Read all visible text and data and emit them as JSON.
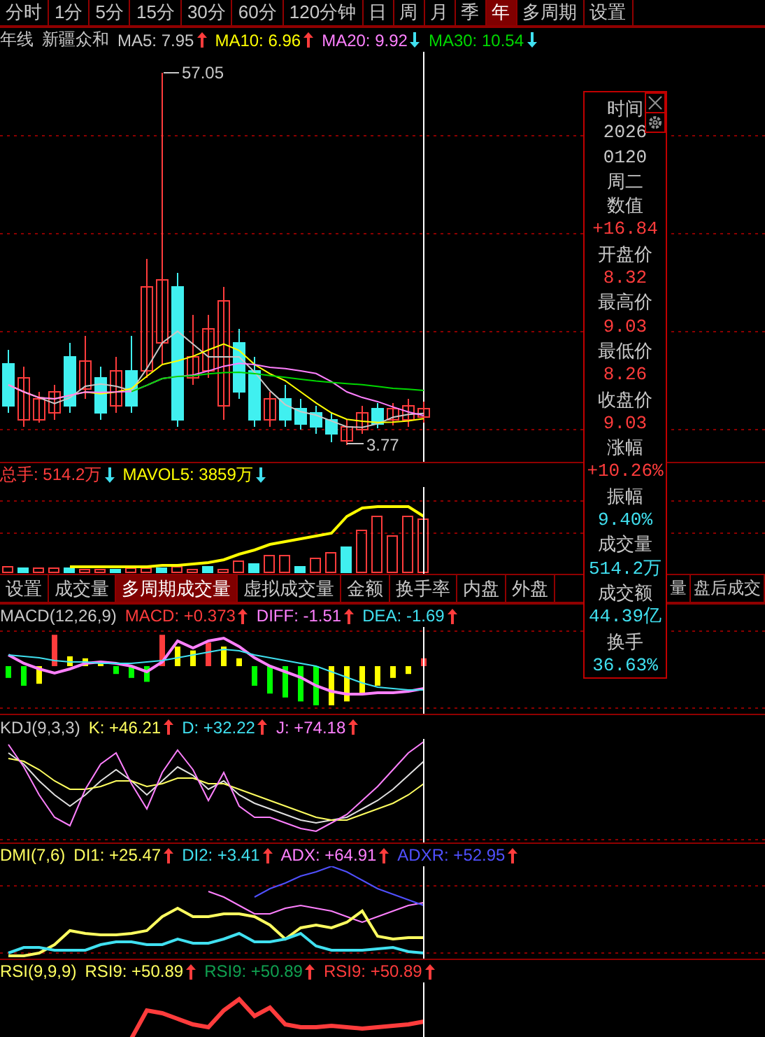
{
  "period_tabs": [
    {
      "label": "分时",
      "selected": false
    },
    {
      "label": "1分",
      "selected": false
    },
    {
      "label": "5分",
      "selected": false
    },
    {
      "label": "15分",
      "selected": false
    },
    {
      "label": "30分",
      "selected": false
    },
    {
      "label": "60分",
      "selected": false
    },
    {
      "label": "120分钟",
      "selected": false
    },
    {
      "label": "日",
      "selected": false
    },
    {
      "label": "周",
      "selected": false
    },
    {
      "label": "月",
      "selected": false
    },
    {
      "label": "季",
      "selected": false
    },
    {
      "label": "年",
      "selected": true
    },
    {
      "label": "多周期",
      "selected": false
    },
    {
      "label": "设置",
      "selected": false
    }
  ],
  "main_chart": {
    "titles": [
      "年线",
      "新疆众和"
    ],
    "lines": [
      {
        "text": "MA5: 7.95",
        "color": "#c8c8c8",
        "rising": true
      },
      {
        "text": "MA10: 6.96",
        "color": "#ffff00",
        "rising": true
      },
      {
        "text": "MA20: 9.92",
        "color": "#ff80ff",
        "rising": false
      },
      {
        "text": "MA30: 10.54",
        "color": "#00d800",
        "rising": false
      }
    ],
    "high_label": "57.05",
    "low_label": "3.77"
  },
  "volume_chart": {
    "lines": [
      {
        "text": "总手: 514.2万",
        "color": "#ff3c3c",
        "rising": false
      },
      {
        "text": "MAVOL5: 3859万",
        "color": "#ffff00",
        "rising": false
      }
    ]
  },
  "indicator_tabs": [
    {
      "label": "设置",
      "selected": false
    },
    {
      "label": "成交量",
      "selected": false
    },
    {
      "label": "多周期成交量",
      "selected": true
    },
    {
      "label": "虚拟成交量",
      "selected": false
    },
    {
      "label": "金额",
      "selected": false
    },
    {
      "label": "换手率",
      "selected": false
    },
    {
      "label": "内盘",
      "selected": false
    },
    {
      "label": "外盘",
      "selected": false
    },
    {
      "label": "量",
      "selected": false
    },
    {
      "label": "盘后成交",
      "selected": false
    }
  ],
  "macd": {
    "lines": [
      {
        "text": "MACD(12,26,9)",
        "color": "#c8c8c8"
      },
      {
        "text": "MACD: +0.373",
        "color": "#ff3c3c",
        "rising": true
      },
      {
        "text": "DIFF: -1.51",
        "color": "#ff80ff",
        "rising": true
      },
      {
        "text": "DEA: -1.69",
        "color": "#40e0f0",
        "rising": true
      }
    ]
  },
  "kdj": {
    "lines": [
      {
        "text": "KDJ(9,3,3)",
        "color": "#c8c8c8"
      },
      {
        "text": "K: +46.21",
        "color": "#ffff60",
        "rising": true
      },
      {
        "text": "D: +32.22",
        "color": "#40e0f0",
        "rising": true
      },
      {
        "text": "J: +74.18",
        "color": "#ff80ff",
        "rising": true
      }
    ]
  },
  "dmi": {
    "lines": [
      {
        "text": "DMI(7,6)",
        "color": "#ffff60"
      },
      {
        "text": "DI1: +25.47",
        "color": "#ffff60",
        "rising": true
      },
      {
        "text": "DI2: +3.41",
        "color": "#40e0f0",
        "rising": true
      },
      {
        "text": "ADX: +64.91",
        "color": "#ff80ff",
        "rising": true
      },
      {
        "text": "ADXR: +52.95",
        "color": "#5050ff",
        "rising": true
      }
    ]
  },
  "rsi": {
    "lines": [
      {
        "text": "RSI(9,9,9)",
        "color": "#ffff60"
      },
      {
        "text": "RSI9: +50.89",
        "color": "#ffff60",
        "rising": true
      },
      {
        "text": "RSI9: +50.89",
        "color": "#10a050",
        "rising": true
      },
      {
        "text": "RSI9: +50.89",
        "color": "#ff3c3c",
        "rising": true
      }
    ]
  },
  "info_popup": {
    "rows": [
      {
        "text": "时间",
        "kind": "label",
        "color": "#c8c8c8"
      },
      {
        "text": "2026",
        "kind": "value",
        "color": "#c8c8c8"
      },
      {
        "text": "0120",
        "kind": "value",
        "color": "#c8c8c8"
      },
      {
        "text": "周二",
        "kind": "label",
        "color": "#c8c8c8"
      },
      {
        "text": "数值",
        "kind": "label",
        "color": "#c8c8c8"
      },
      {
        "text": "+16.84",
        "kind": "value",
        "color": "#ff3c3c"
      },
      {
        "text": "开盘价",
        "kind": "label",
        "color": "#c8c8c8"
      },
      {
        "text": "8.32",
        "kind": "value",
        "color": "#ff3c3c"
      },
      {
        "text": "最高价",
        "kind": "label",
        "color": "#c8c8c8"
      },
      {
        "text": "9.03",
        "kind": "value",
        "color": "#ff3c3c"
      },
      {
        "text": "最低价",
        "kind": "label",
        "color": "#c8c8c8"
      },
      {
        "text": "8.26",
        "kind": "value",
        "color": "#ff3c3c"
      },
      {
        "text": "收盘价",
        "kind": "label",
        "color": "#c8c8c8"
      },
      {
        "text": "9.03",
        "kind": "value",
        "color": "#ff3c3c"
      },
      {
        "text": "涨幅",
        "kind": "label",
        "color": "#c8c8c8"
      },
      {
        "text": "+10.26%",
        "kind": "value",
        "color": "#ff3c3c"
      },
      {
        "text": "振幅",
        "kind": "label",
        "color": "#c8c8c8"
      },
      {
        "text": "9.40%",
        "kind": "value",
        "color": "#40e0f0"
      },
      {
        "text": "成交量",
        "kind": "label",
        "color": "#c8c8c8"
      },
      {
        "text": "514.2万",
        "kind": "value",
        "color": "#40e0f0"
      },
      {
        "text": "成交额",
        "kind": "label",
        "color": "#c8c8c8"
      },
      {
        "text": "44.39亿",
        "kind": "value",
        "color": "#40e0f0"
      },
      {
        "text": "换手",
        "kind": "label",
        "color": "#c8c8c8"
      },
      {
        "text": "36.63%",
        "kind": "value",
        "color": "#40e0f0"
      }
    ]
  }
}
